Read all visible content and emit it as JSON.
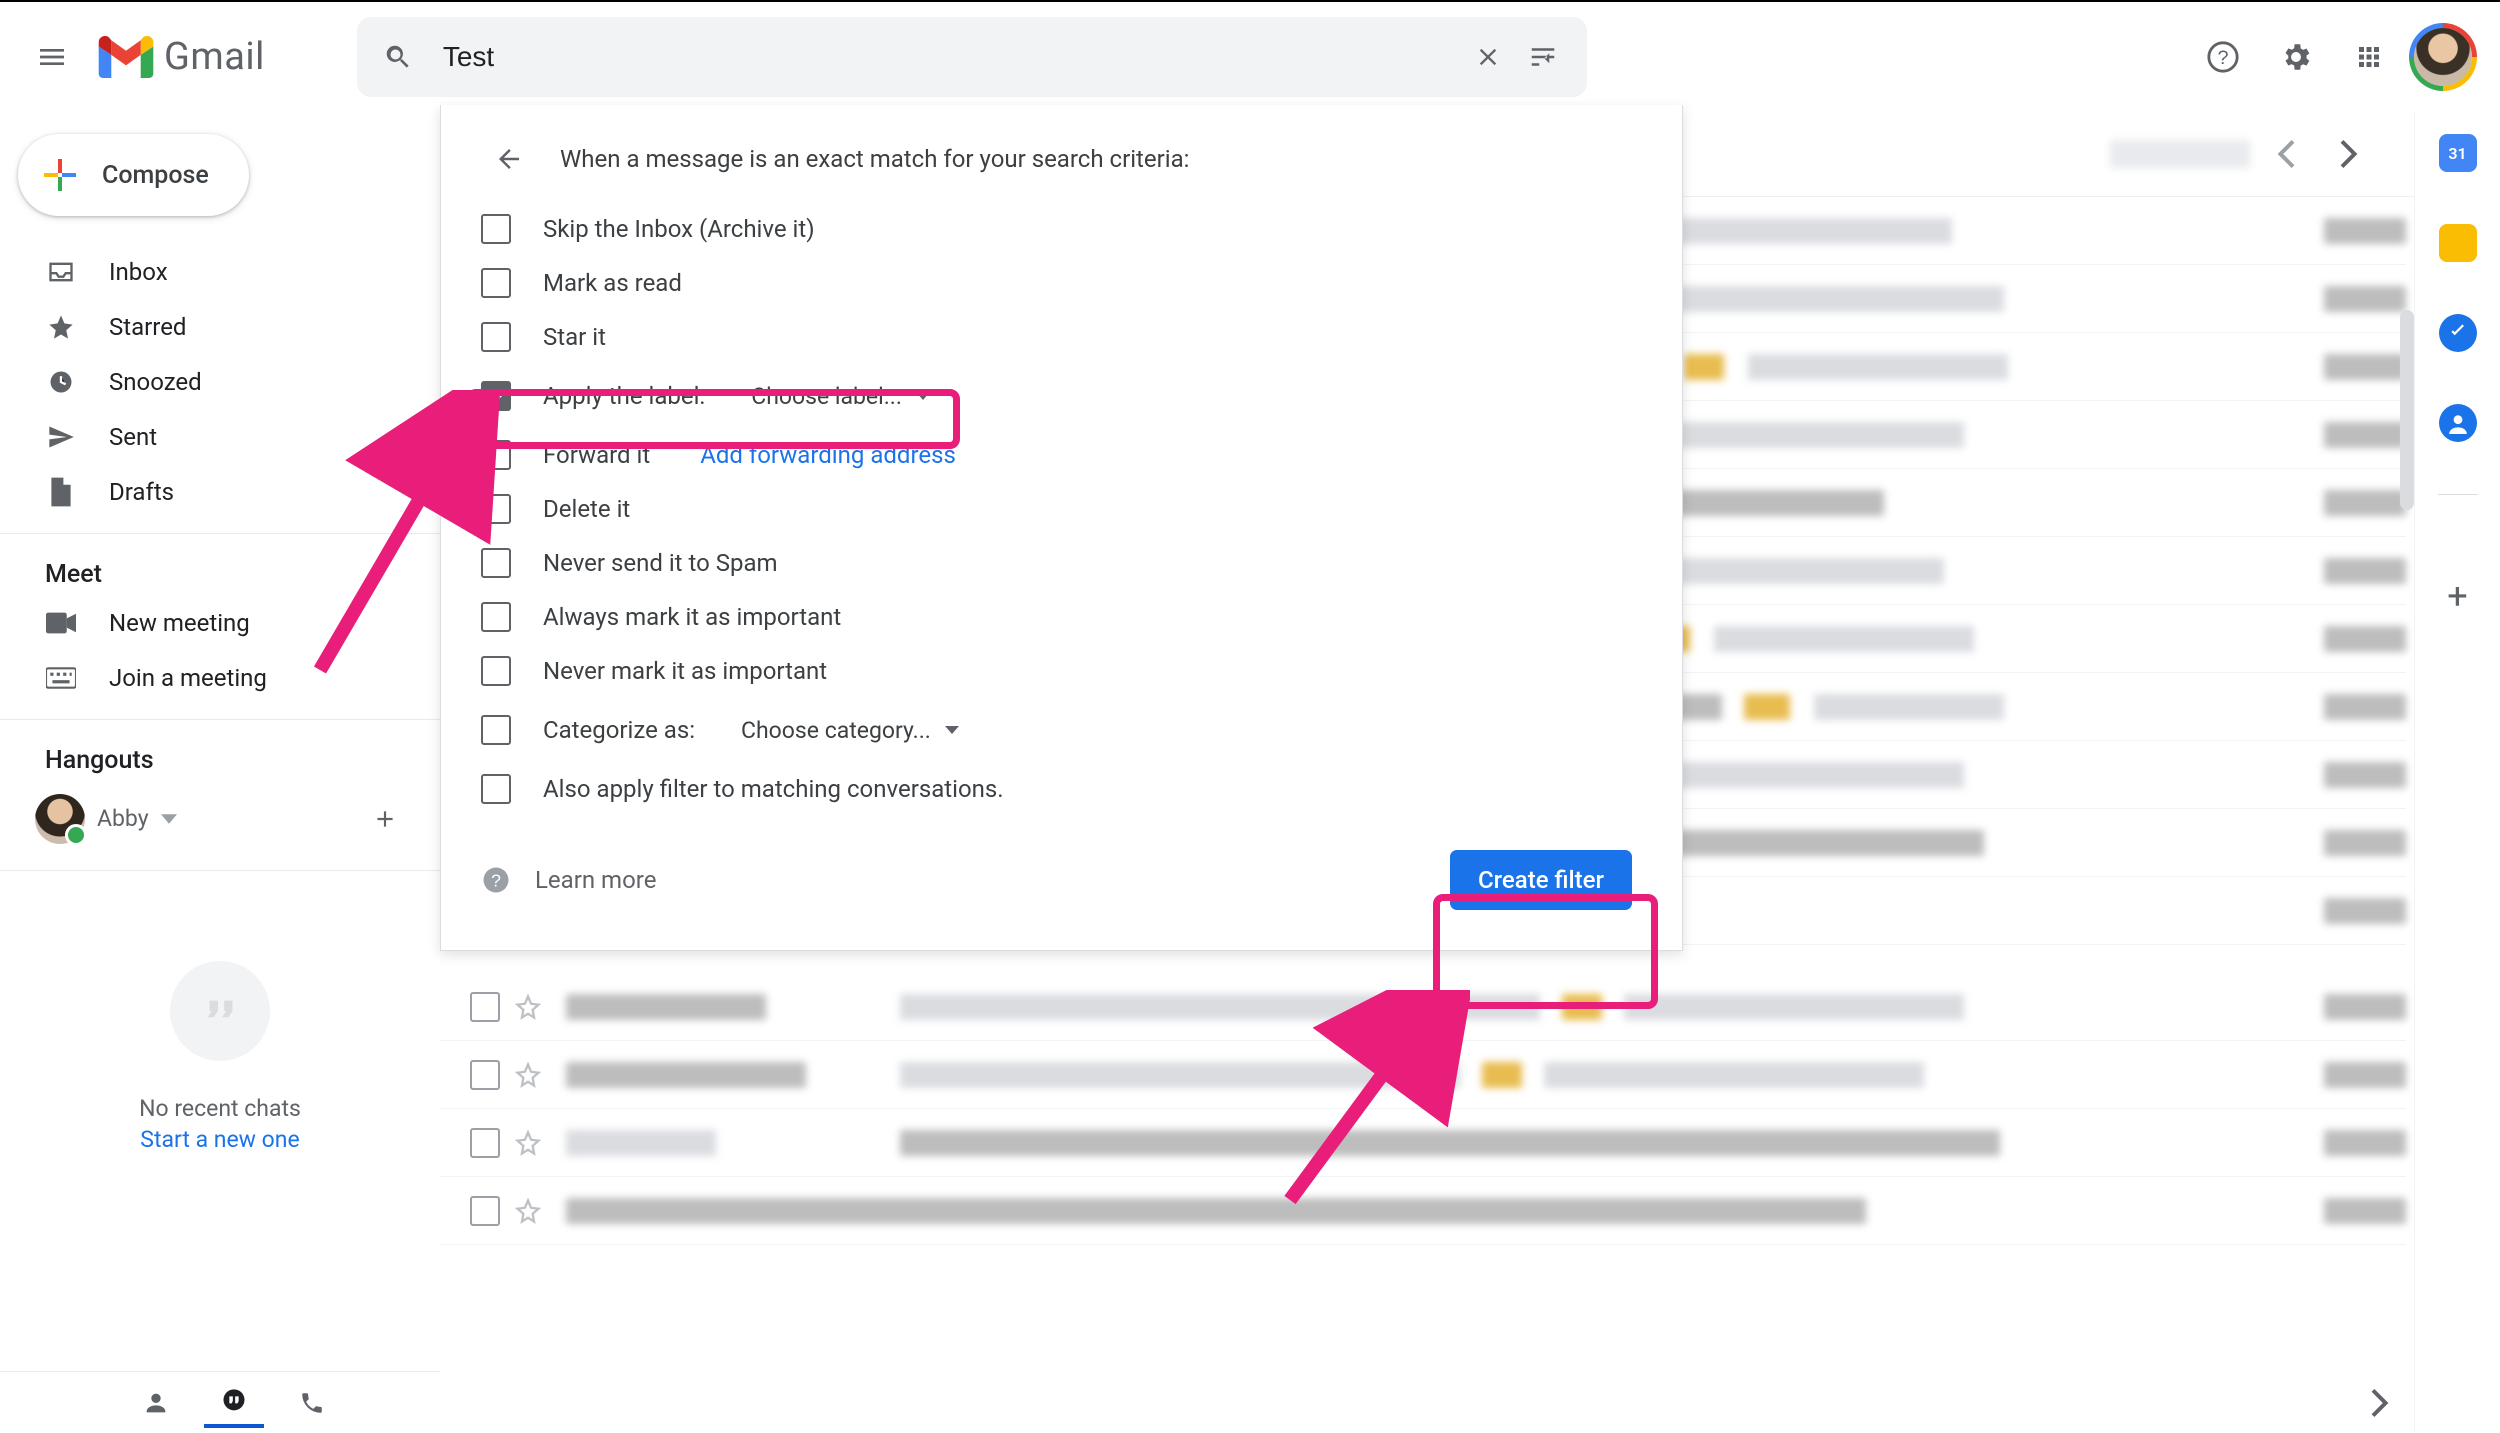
{
  "header": {
    "gmail_text": "Gmail",
    "search_value": "Test"
  },
  "sidebar": {
    "compose": "Compose",
    "nav": {
      "inbox": "Inbox",
      "starred": "Starred",
      "snoozed": "Snoozed",
      "sent": "Sent",
      "drafts": "Drafts"
    },
    "meet_label": "Meet",
    "meet": {
      "new_meeting": "New meeting",
      "join_meeting": "Join a meeting"
    },
    "hangouts_label": "Hangouts",
    "hangouts_user": "Abby",
    "no_chats": "No recent chats",
    "start_chat": "Start a new one"
  },
  "filter": {
    "heading": "When a message is an exact match for your search criteria:",
    "options": {
      "skip_inbox": "Skip the Inbox (Archive it)",
      "mark_read": "Mark as read",
      "star_it": "Star it",
      "apply_label": "Apply the label:",
      "choose_label": "Choose label...",
      "forward_it": "Forward it",
      "add_fwd": "Add forwarding address",
      "delete_it": "Delete it",
      "never_spam": "Never send it to Spam",
      "always_important": "Always mark it as important",
      "never_important": "Never mark it as important",
      "categorize_as": "Categorize as:",
      "choose_category": "Choose category...",
      "also_apply": "Also apply filter to matching conversations."
    },
    "learn_more": "Learn more",
    "create_filter": "Create filter"
  }
}
